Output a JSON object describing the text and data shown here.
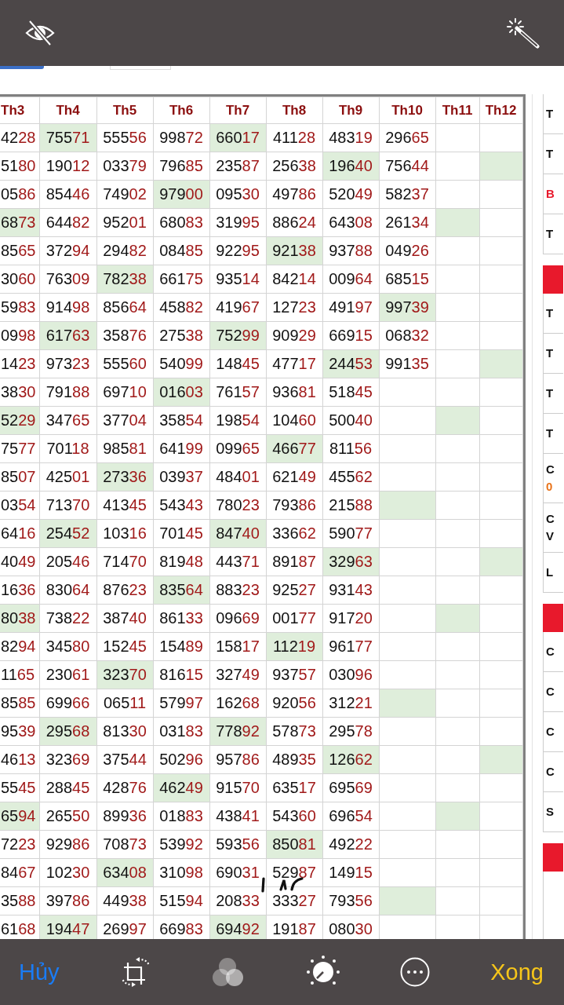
{
  "table": {
    "columns": [
      "Th3",
      "Th4",
      "Th5",
      "Th6",
      "Th7",
      "Th8",
      "Th9",
      "Th10",
      "Th11",
      "Th12"
    ],
    "rows": [
      {
        "cells": [
          {
            "value": "4228",
            "highlighted": false
          },
          {
            "value": "75571",
            "highlighted": true
          },
          {
            "value": "55556",
            "highlighted": false
          },
          {
            "value": "99872",
            "highlighted": false
          },
          {
            "value": "66017",
            "highlighted": true
          },
          {
            "value": "41128",
            "highlighted": false
          },
          {
            "value": "48319",
            "highlighted": false
          },
          {
            "value": "29665",
            "highlighted": false
          },
          {
            "highlighted": false
          },
          {
            "highlighted": false
          }
        ]
      },
      {
        "cells": [
          {
            "value": "5180",
            "highlighted": false
          },
          {
            "value": "19012",
            "highlighted": false
          },
          {
            "value": "03379",
            "highlighted": false
          },
          {
            "value": "79685",
            "highlighted": false
          },
          {
            "value": "23587",
            "highlighted": false
          },
          {
            "value": "25638",
            "highlighted": false
          },
          {
            "value": "19640",
            "highlighted": true
          },
          {
            "value": "75644",
            "highlighted": false
          },
          {
            "highlighted": false
          },
          {
            "highlighted": true
          }
        ]
      },
      {
        "cells": [
          {
            "value": "0586",
            "highlighted": false
          },
          {
            "value": "85446",
            "highlighted": false
          },
          {
            "value": "74902",
            "highlighted": false
          },
          {
            "value": "97900",
            "highlighted": true
          },
          {
            "value": "09530",
            "highlighted": false
          },
          {
            "value": "49786",
            "highlighted": false
          },
          {
            "value": "52049",
            "highlighted": false
          },
          {
            "value": "58237",
            "highlighted": false
          },
          {
            "highlighted": false
          },
          {
            "highlighted": false
          }
        ]
      },
      {
        "cells": [
          {
            "value": "6873",
            "highlighted": true
          },
          {
            "value": "64482",
            "highlighted": false
          },
          {
            "value": "95201",
            "highlighted": false
          },
          {
            "value": "68083",
            "highlighted": false
          },
          {
            "value": "31995",
            "highlighted": false
          },
          {
            "value": "88624",
            "highlighted": false
          },
          {
            "value": "64308",
            "highlighted": false
          },
          {
            "value": "26134",
            "highlighted": false
          },
          {
            "highlighted": true
          },
          {
            "highlighted": false
          }
        ]
      },
      {
        "cells": [
          {
            "value": "8565",
            "highlighted": false
          },
          {
            "value": "37294",
            "highlighted": false
          },
          {
            "value": "29482",
            "highlighted": false
          },
          {
            "value": "08485",
            "highlighted": false
          },
          {
            "value": "92295",
            "highlighted": false
          },
          {
            "value": "92138",
            "highlighted": true
          },
          {
            "value": "93788",
            "highlighted": false
          },
          {
            "value": "04926",
            "highlighted": false
          },
          {
            "highlighted": false
          },
          {
            "highlighted": false
          }
        ]
      },
      {
        "cells": [
          {
            "value": "3060",
            "highlighted": false
          },
          {
            "value": "76309",
            "highlighted": false
          },
          {
            "value": "78238",
            "highlighted": true
          },
          {
            "value": "66175",
            "highlighted": false
          },
          {
            "value": "93514",
            "highlighted": false
          },
          {
            "value": "84214",
            "highlighted": false
          },
          {
            "value": "00964",
            "highlighted": false
          },
          {
            "value": "68515",
            "highlighted": false
          },
          {
            "highlighted": false
          },
          {
            "highlighted": false
          }
        ]
      },
      {
        "cells": [
          {
            "value": "5983",
            "highlighted": false
          },
          {
            "value": "91498",
            "highlighted": false
          },
          {
            "value": "85664",
            "highlighted": false
          },
          {
            "value": "45882",
            "highlighted": false
          },
          {
            "value": "41967",
            "highlighted": false
          },
          {
            "value": "12723",
            "highlighted": false
          },
          {
            "value": "49197",
            "highlighted": false
          },
          {
            "value": "99739",
            "highlighted": true
          },
          {
            "highlighted": false
          },
          {
            "highlighted": false
          }
        ]
      },
      {
        "cells": [
          {
            "value": "0998",
            "highlighted": false
          },
          {
            "value": "61763",
            "highlighted": true
          },
          {
            "value": "35876",
            "highlighted": false
          },
          {
            "value": "27538",
            "highlighted": false
          },
          {
            "value": "75299",
            "highlighted": true
          },
          {
            "value": "90929",
            "highlighted": false
          },
          {
            "value": "66915",
            "highlighted": false
          },
          {
            "value": "06832",
            "highlighted": false
          },
          {
            "highlighted": false
          },
          {
            "highlighted": false
          }
        ]
      },
      {
        "cells": [
          {
            "value": "1423",
            "highlighted": false
          },
          {
            "value": "97323",
            "highlighted": false
          },
          {
            "value": "55560",
            "highlighted": false
          },
          {
            "value": "54099",
            "highlighted": false
          },
          {
            "value": "14845",
            "highlighted": false
          },
          {
            "value": "47717",
            "highlighted": false
          },
          {
            "value": "24453",
            "highlighted": true
          },
          {
            "value": "99135",
            "highlighted": false
          },
          {
            "highlighted": false
          },
          {
            "highlighted": true
          }
        ]
      },
      {
        "cells": [
          {
            "value": "3830",
            "highlighted": false
          },
          {
            "value": "79188",
            "highlighted": false
          },
          {
            "value": "69710",
            "highlighted": false
          },
          {
            "value": "01603",
            "highlighted": true
          },
          {
            "value": "76157",
            "highlighted": false
          },
          {
            "value": "93681",
            "highlighted": false
          },
          {
            "value": "51845",
            "highlighted": false
          },
          {
            "highlighted": false
          },
          {
            "highlighted": false
          },
          {
            "highlighted": false
          }
        ]
      },
      {
        "cells": [
          {
            "value": "5229",
            "highlighted": true
          },
          {
            "value": "34765",
            "highlighted": false
          },
          {
            "value": "37704",
            "highlighted": false
          },
          {
            "value": "35854",
            "highlighted": false
          },
          {
            "value": "19854",
            "highlighted": false
          },
          {
            "value": "10460",
            "highlighted": false
          },
          {
            "value": "50040",
            "highlighted": false
          },
          {
            "highlighted": false
          },
          {
            "highlighted": true
          },
          {
            "highlighted": false
          }
        ]
      },
      {
        "cells": [
          {
            "value": "7577",
            "highlighted": false
          },
          {
            "value": "70118",
            "highlighted": false
          },
          {
            "value": "98581",
            "highlighted": false
          },
          {
            "value": "64199",
            "highlighted": false
          },
          {
            "value": "09965",
            "highlighted": false
          },
          {
            "value": "46677",
            "highlighted": true
          },
          {
            "value": "81156",
            "highlighted": false
          },
          {
            "highlighted": false
          },
          {
            "highlighted": false
          },
          {
            "highlighted": false
          }
        ]
      },
      {
        "cells": [
          {
            "value": "8507",
            "highlighted": false
          },
          {
            "value": "42501",
            "highlighted": false
          },
          {
            "value": "27336",
            "highlighted": true
          },
          {
            "value": "03937",
            "highlighted": false
          },
          {
            "value": "48401",
            "highlighted": false
          },
          {
            "value": "62149",
            "highlighted": false
          },
          {
            "value": "45562",
            "highlighted": false
          },
          {
            "highlighted": false
          },
          {
            "highlighted": false
          },
          {
            "highlighted": false
          }
        ]
      },
      {
        "cells": [
          {
            "value": "0354",
            "highlighted": false
          },
          {
            "value": "71370",
            "highlighted": false
          },
          {
            "value": "41345",
            "highlighted": false
          },
          {
            "value": "54343",
            "highlighted": false
          },
          {
            "value": "78023",
            "highlighted": false
          },
          {
            "value": "79386",
            "highlighted": false
          },
          {
            "value": "21588",
            "highlighted": false
          },
          {
            "highlighted": true
          },
          {
            "highlighted": false
          },
          {
            "highlighted": false
          }
        ]
      },
      {
        "cells": [
          {
            "value": "6416",
            "highlighted": false
          },
          {
            "value": "25452",
            "highlighted": true
          },
          {
            "value": "10316",
            "highlighted": false
          },
          {
            "value": "70145",
            "highlighted": false
          },
          {
            "value": "84740",
            "highlighted": true
          },
          {
            "value": "33662",
            "highlighted": false
          },
          {
            "value": "59077",
            "highlighted": false
          },
          {
            "highlighted": false
          },
          {
            "highlighted": false
          },
          {
            "highlighted": false
          }
        ]
      },
      {
        "cells": [
          {
            "value": "4049",
            "highlighted": false
          },
          {
            "value": "20546",
            "highlighted": false
          },
          {
            "value": "71470",
            "highlighted": false
          },
          {
            "value": "81948",
            "highlighted": false
          },
          {
            "value": "44371",
            "highlighted": false
          },
          {
            "value": "89187",
            "highlighted": false
          },
          {
            "value": "32963",
            "highlighted": true
          },
          {
            "highlighted": false
          },
          {
            "highlighted": false
          },
          {
            "highlighted": true
          }
        ]
      },
      {
        "cells": [
          {
            "value": "1636",
            "highlighted": false
          },
          {
            "value": "83064",
            "highlighted": false
          },
          {
            "value": "87623",
            "highlighted": false
          },
          {
            "value": "83564",
            "highlighted": true
          },
          {
            "value": "88323",
            "highlighted": false
          },
          {
            "value": "92527",
            "highlighted": false
          },
          {
            "value": "93143",
            "highlighted": false
          },
          {
            "highlighted": false
          },
          {
            "highlighted": false
          },
          {
            "highlighted": false
          }
        ]
      },
      {
        "cells": [
          {
            "value": "8038",
            "highlighted": true
          },
          {
            "value": "73822",
            "highlighted": false
          },
          {
            "value": "38740",
            "highlighted": false
          },
          {
            "value": "86133",
            "highlighted": false
          },
          {
            "value": "09669",
            "highlighted": false
          },
          {
            "value": "00177",
            "highlighted": false
          },
          {
            "value": "91720",
            "highlighted": false
          },
          {
            "highlighted": false
          },
          {
            "highlighted": true
          },
          {
            "highlighted": false
          }
        ]
      },
      {
        "cells": [
          {
            "value": "8294",
            "highlighted": false
          },
          {
            "value": "34580",
            "highlighted": false
          },
          {
            "value": "15245",
            "highlighted": false
          },
          {
            "value": "15489",
            "highlighted": false
          },
          {
            "value": "15817",
            "highlighted": false
          },
          {
            "value": "11219",
            "highlighted": true
          },
          {
            "value": "96177",
            "highlighted": false
          },
          {
            "highlighted": false
          },
          {
            "highlighted": false
          },
          {
            "highlighted": false
          }
        ]
      },
      {
        "cells": [
          {
            "value": "1165",
            "highlighted": false
          },
          {
            "value": "23061",
            "highlighted": false
          },
          {
            "value": "32370",
            "highlighted": true
          },
          {
            "value": "81615",
            "highlighted": false
          },
          {
            "value": "32749",
            "highlighted": false
          },
          {
            "value": "93757",
            "highlighted": false
          },
          {
            "value": "03096",
            "highlighted": false
          },
          {
            "highlighted": false
          },
          {
            "highlighted": false
          },
          {
            "highlighted": false
          }
        ]
      },
      {
        "cells": [
          {
            "value": "8585",
            "highlighted": false
          },
          {
            "value": "69966",
            "highlighted": false
          },
          {
            "value": "06511",
            "highlighted": false
          },
          {
            "value": "57997",
            "highlighted": false
          },
          {
            "value": "16268",
            "highlighted": false
          },
          {
            "value": "92056",
            "highlighted": false
          },
          {
            "value": "31221",
            "highlighted": false
          },
          {
            "highlighted": true
          },
          {
            "highlighted": false
          },
          {
            "highlighted": false
          }
        ]
      },
      {
        "cells": [
          {
            "value": "9539",
            "highlighted": false
          },
          {
            "value": "29568",
            "highlighted": true
          },
          {
            "value": "81330",
            "highlighted": false
          },
          {
            "value": "03183",
            "highlighted": false
          },
          {
            "value": "77892",
            "highlighted": true
          },
          {
            "value": "57873",
            "highlighted": false
          },
          {
            "value": "29578",
            "highlighted": false
          },
          {
            "highlighted": false
          },
          {
            "highlighted": false
          },
          {
            "highlighted": false
          }
        ]
      },
      {
        "cells": [
          {
            "value": "4613",
            "highlighted": false
          },
          {
            "value": "32369",
            "highlighted": false
          },
          {
            "value": "37544",
            "highlighted": false
          },
          {
            "value": "50296",
            "highlighted": false
          },
          {
            "value": "95786",
            "highlighted": false
          },
          {
            "value": "48935",
            "highlighted": false
          },
          {
            "value": "12662",
            "highlighted": true
          },
          {
            "highlighted": false
          },
          {
            "highlighted": false
          },
          {
            "highlighted": true
          }
        ]
      },
      {
        "cells": [
          {
            "value": "5545",
            "highlighted": false
          },
          {
            "value": "28845",
            "highlighted": false
          },
          {
            "value": "42876",
            "highlighted": false
          },
          {
            "value": "46249",
            "highlighted": true
          },
          {
            "value": "91570",
            "highlighted": false
          },
          {
            "value": "63517",
            "highlighted": false
          },
          {
            "value": "69569",
            "highlighted": false
          },
          {
            "highlighted": false
          },
          {
            "highlighted": false
          },
          {
            "highlighted": false
          }
        ]
      },
      {
        "cells": [
          {
            "value": "6594",
            "highlighted": true
          },
          {
            "value": "26550",
            "highlighted": false
          },
          {
            "value": "89936",
            "highlighted": false
          },
          {
            "value": "01883",
            "highlighted": false
          },
          {
            "value": "43841",
            "highlighted": false
          },
          {
            "value": "54360",
            "highlighted": false
          },
          {
            "value": "69654",
            "highlighted": false
          },
          {
            "highlighted": false
          },
          {
            "highlighted": true
          },
          {
            "highlighted": false
          }
        ]
      },
      {
        "cells": [
          {
            "value": "7223",
            "highlighted": false
          },
          {
            "value": "92986",
            "highlighted": false
          },
          {
            "value": "70873",
            "highlighted": false
          },
          {
            "value": "53992",
            "highlighted": false
          },
          {
            "value": "59356",
            "highlighted": false
          },
          {
            "value": "85081",
            "highlighted": true
          },
          {
            "value": "49222",
            "highlighted": false
          },
          {
            "highlighted": false
          },
          {
            "highlighted": false
          },
          {
            "highlighted": false
          }
        ]
      },
      {
        "cells": [
          {
            "value": "8467",
            "highlighted": false
          },
          {
            "value": "10230",
            "highlighted": false
          },
          {
            "value": "63408",
            "highlighted": true
          },
          {
            "value": "31098",
            "highlighted": false
          },
          {
            "value": "69031",
            "highlighted": false
          },
          {
            "value": "52987",
            "highlighted": false
          },
          {
            "value": "14915",
            "highlighted": false
          },
          {
            "highlighted": false
          },
          {
            "highlighted": false
          },
          {
            "highlighted": false
          }
        ]
      },
      {
        "cells": [
          {
            "value": "3588",
            "highlighted": false
          },
          {
            "value": "39786",
            "highlighted": false
          },
          {
            "value": "44938",
            "highlighted": false
          },
          {
            "value": "51594",
            "highlighted": false
          },
          {
            "value": "20833",
            "highlighted": false
          },
          {
            "value": "33327",
            "highlighted": false
          },
          {
            "value": "79356",
            "highlighted": false
          },
          {
            "highlighted": true
          },
          {
            "highlighted": false
          },
          {
            "highlighted": false
          }
        ]
      },
      {
        "cells": [
          {
            "value": "6168",
            "highlighted": false
          },
          {
            "value": "19447",
            "highlighted": true
          },
          {
            "value": "26997",
            "highlighted": false
          },
          {
            "value": "66983",
            "highlighted": false
          },
          {
            "value": "69492",
            "highlighted": true
          },
          {
            "value": "19187",
            "highlighted": false
          },
          {
            "value": "08030",
            "highlighted": false
          },
          {
            "highlighted": false
          },
          {
            "highlighted": false
          },
          {
            "highlighted": false
          }
        ]
      }
    ]
  },
  "side_panel": {
    "sections": [
      {
        "has_header": false,
        "rows": [
          {
            "lines": [
              {
                "text": "T",
                "color": "#111111"
              }
            ]
          },
          {
            "lines": [
              {
                "text": "T",
                "color": "#111111"
              }
            ]
          },
          {
            "lines": [
              {
                "text": "B",
                "color": "#e8192c"
              }
            ]
          },
          {
            "lines": [
              {
                "text": "T",
                "color": "#111111"
              }
            ]
          }
        ]
      },
      {
        "has_header": true,
        "rows": [
          {
            "lines": [
              {
                "text": "T",
                "color": "#111111"
              }
            ]
          },
          {
            "lines": [
              {
                "text": "T",
                "color": "#111111"
              }
            ]
          },
          {
            "lines": [
              {
                "text": "T",
                "color": "#111111"
              }
            ]
          },
          {
            "lines": [
              {
                "text": "T",
                "color": "#111111"
              }
            ]
          },
          {
            "lines": [
              {
                "text": "C",
                "color": "#111111"
              },
              {
                "text": "0",
                "color": "#e8731a"
              }
            ]
          },
          {
            "lines": [
              {
                "text": "C",
                "color": "#111111"
              },
              {
                "text": "V",
                "color": "#111111"
              }
            ]
          },
          {
            "lines": [
              {
                "text": "L",
                "color": "#111111"
              }
            ]
          }
        ]
      },
      {
        "has_header": true,
        "rows": [
          {
            "lines": [
              {
                "text": "C",
                "color": "#111111"
              }
            ]
          },
          {
            "lines": [
              {
                "text": "C",
                "color": "#111111"
              }
            ]
          },
          {
            "lines": [
              {
                "text": "C",
                "color": "#111111"
              }
            ]
          },
          {
            "lines": [
              {
                "text": "C",
                "color": "#111111"
              }
            ]
          },
          {
            "lines": [
              {
                "text": "S",
                "color": "#111111"
              }
            ]
          }
        ]
      },
      {
        "has_header": true
      }
    ]
  },
  "bottom_bar": {
    "cancel": "Hủy",
    "done": "Xong"
  }
}
